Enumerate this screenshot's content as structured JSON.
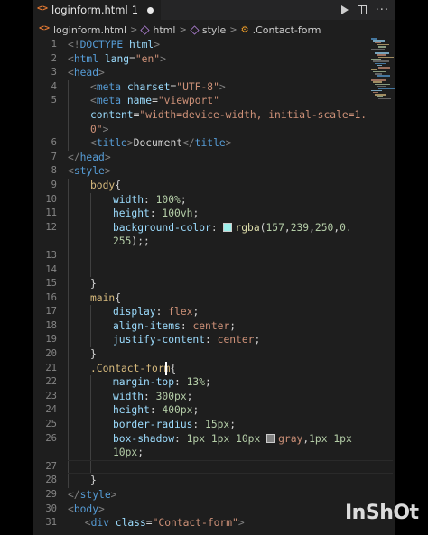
{
  "tab": {
    "filename": "loginform.html",
    "badge": "1"
  },
  "breadcrumb": [
    "loginform.html",
    "html",
    "style",
    ".Contact-form"
  ],
  "code_lines": [
    {
      "n": "1",
      "segs": [
        {
          "c": "t-br",
          "t": "<!"
        },
        {
          "c": "t-tag",
          "t": "DOCTYPE"
        },
        {
          "c": "t-def",
          "t": " "
        },
        {
          "c": "t-attr",
          "t": "html"
        },
        {
          "c": "t-br",
          "t": ">"
        }
      ],
      "indent": 0
    },
    {
      "n": "2",
      "segs": [
        {
          "c": "t-br",
          "t": "<"
        },
        {
          "c": "t-tag",
          "t": "html"
        },
        {
          "c": "t-def",
          "t": " "
        },
        {
          "c": "t-attr",
          "t": "lang"
        },
        {
          "c": "t-def",
          "t": "="
        },
        {
          "c": "t-str",
          "t": "\"en\""
        },
        {
          "c": "t-br",
          "t": ">"
        }
      ],
      "indent": 0
    },
    {
      "n": "3",
      "segs": [
        {
          "c": "t-br",
          "t": "<"
        },
        {
          "c": "t-tag",
          "t": "head"
        },
        {
          "c": "t-br",
          "t": ">"
        }
      ],
      "indent": 0
    },
    {
      "n": "4",
      "segs": [
        {
          "c": "t-br",
          "t": "<"
        },
        {
          "c": "t-tag",
          "t": "meta"
        },
        {
          "c": "t-def",
          "t": " "
        },
        {
          "c": "t-attr",
          "t": "charset"
        },
        {
          "c": "t-def",
          "t": "="
        },
        {
          "c": "t-str",
          "t": "\"UTF-8\""
        },
        {
          "c": "t-br",
          "t": ">"
        }
      ],
      "indent": 1
    },
    {
      "n": "5",
      "segs": [
        {
          "c": "t-br",
          "t": "<"
        },
        {
          "c": "t-tag",
          "t": "meta"
        },
        {
          "c": "t-def",
          "t": " "
        },
        {
          "c": "t-attr",
          "t": "name"
        },
        {
          "c": "t-def",
          "t": "="
        },
        {
          "c": "t-str",
          "t": "\"viewport\""
        }
      ],
      "indent": 1
    },
    {
      "n": "",
      "segs": [
        {
          "c": "t-attr",
          "t": "content"
        },
        {
          "c": "t-def",
          "t": "="
        },
        {
          "c": "t-str",
          "t": "\"width=device-width, initial-scale=1."
        }
      ],
      "indent": 1
    },
    {
      "n": "",
      "segs": [
        {
          "c": "t-str",
          "t": "0\""
        },
        {
          "c": "t-br",
          "t": ">"
        }
      ],
      "indent": 1
    },
    {
      "n": "6",
      "segs": [
        {
          "c": "t-br",
          "t": "<"
        },
        {
          "c": "t-tag",
          "t": "title"
        },
        {
          "c": "t-br",
          "t": ">"
        },
        {
          "c": "t-def",
          "t": "Document"
        },
        {
          "c": "t-br",
          "t": "</"
        },
        {
          "c": "t-tag",
          "t": "title"
        },
        {
          "c": "t-br",
          "t": ">"
        }
      ],
      "indent": 1
    },
    {
      "n": "7",
      "segs": [
        {
          "c": "t-br",
          "t": "</"
        },
        {
          "c": "t-tag",
          "t": "head"
        },
        {
          "c": "t-br",
          "t": ">"
        }
      ],
      "indent": 0
    },
    {
      "n": "8",
      "segs": [
        {
          "c": "t-br",
          "t": "<"
        },
        {
          "c": "t-tag",
          "t": "style"
        },
        {
          "c": "t-br",
          "t": ">"
        }
      ],
      "indent": 0
    },
    {
      "n": "9",
      "segs": [
        {
          "c": "t-sel",
          "t": "body"
        },
        {
          "c": "t-def",
          "t": "{"
        }
      ],
      "indent": 1
    },
    {
      "n": "10",
      "segs": [
        {
          "c": "t-prop",
          "t": "width"
        },
        {
          "c": "t-def",
          "t": ": "
        },
        {
          "c": "t-num",
          "t": "100%"
        },
        {
          "c": "t-def",
          "t": ";"
        }
      ],
      "indent": 2
    },
    {
      "n": "11",
      "segs": [
        {
          "c": "t-prop",
          "t": "height"
        },
        {
          "c": "t-def",
          "t": ": "
        },
        {
          "c": "t-num",
          "t": "100vh"
        },
        {
          "c": "t-def",
          "t": ";"
        }
      ],
      "indent": 2
    },
    {
      "n": "12",
      "segs": [
        {
          "c": "t-prop",
          "t": "background-color"
        },
        {
          "c": "t-def",
          "t": ": "
        },
        {
          "c": "swatch",
          "t": "#9defea"
        },
        {
          "c": "t-fn",
          "t": "rgba"
        },
        {
          "c": "t-def",
          "t": "("
        },
        {
          "c": "t-num",
          "t": "157"
        },
        {
          "c": "t-def",
          "t": ","
        },
        {
          "c": "t-num",
          "t": "239"
        },
        {
          "c": "t-def",
          "t": ","
        },
        {
          "c": "t-num",
          "t": "250"
        },
        {
          "c": "t-def",
          "t": ","
        },
        {
          "c": "t-num",
          "t": "0."
        }
      ],
      "indent": 2
    },
    {
      "n": "",
      "segs": [
        {
          "c": "t-num",
          "t": "255"
        },
        {
          "c": "t-def",
          "t": ");;"
        }
      ],
      "indent": 2
    },
    {
      "n": "13",
      "segs": [],
      "indent": 2
    },
    {
      "n": "14",
      "segs": [],
      "indent": 2
    },
    {
      "n": "15",
      "segs": [
        {
          "c": "t-def",
          "t": "}"
        }
      ],
      "indent": 1
    },
    {
      "n": "16",
      "segs": [
        {
          "c": "t-sel",
          "t": "main"
        },
        {
          "c": "t-def",
          "t": "{"
        }
      ],
      "indent": 1
    },
    {
      "n": "17",
      "segs": [
        {
          "c": "t-prop",
          "t": "display"
        },
        {
          "c": "t-def",
          "t": ": "
        },
        {
          "c": "t-str",
          "t": "flex"
        },
        {
          "c": "t-def",
          "t": ";"
        }
      ],
      "indent": 2
    },
    {
      "n": "18",
      "segs": [
        {
          "c": "t-prop",
          "t": "align-items"
        },
        {
          "c": "t-def",
          "t": ": "
        },
        {
          "c": "t-str",
          "t": "center"
        },
        {
          "c": "t-def",
          "t": ";"
        }
      ],
      "indent": 2
    },
    {
      "n": "19",
      "segs": [
        {
          "c": "t-prop",
          "t": "justify-content"
        },
        {
          "c": "t-def",
          "t": ": "
        },
        {
          "c": "t-str",
          "t": "center"
        },
        {
          "c": "t-def",
          "t": ";"
        }
      ],
      "indent": 2
    },
    {
      "n": "20",
      "segs": [
        {
          "c": "t-def",
          "t": "}"
        }
      ],
      "indent": 1
    },
    {
      "n": "21",
      "segs": [
        {
          "c": "t-sel",
          "t": ".Contact-form"
        },
        {
          "c": "t-def",
          "t": "{"
        }
      ],
      "indent": 1
    },
    {
      "n": "22",
      "segs": [
        {
          "c": "t-prop",
          "t": "margin-top"
        },
        {
          "c": "t-def",
          "t": ": "
        },
        {
          "c": "t-num",
          "t": "13%"
        },
        {
          "c": "t-def",
          "t": ";"
        }
      ],
      "indent": 2
    },
    {
      "n": "23",
      "segs": [
        {
          "c": "t-prop",
          "t": "width"
        },
        {
          "c": "t-def",
          "t": ": "
        },
        {
          "c": "t-num",
          "t": "300px"
        },
        {
          "c": "t-def",
          "t": ";"
        }
      ],
      "indent": 2
    },
    {
      "n": "24",
      "segs": [
        {
          "c": "t-prop",
          "t": "height"
        },
        {
          "c": "t-def",
          "t": ": "
        },
        {
          "c": "t-num",
          "t": "400px"
        },
        {
          "c": "t-def",
          "t": ";"
        }
      ],
      "indent": 2
    },
    {
      "n": "25",
      "segs": [
        {
          "c": "t-prop",
          "t": "border-radius"
        },
        {
          "c": "t-def",
          "t": ": "
        },
        {
          "c": "t-num",
          "t": "15px"
        },
        {
          "c": "t-def",
          "t": ";"
        }
      ],
      "indent": 2
    },
    {
      "n": "26",
      "segs": [
        {
          "c": "t-prop",
          "t": "box-shadow"
        },
        {
          "c": "t-def",
          "t": ": "
        },
        {
          "c": "t-num",
          "t": "1px"
        },
        {
          "c": "t-def",
          "t": " "
        },
        {
          "c": "t-num",
          "t": "1px"
        },
        {
          "c": "t-def",
          "t": " "
        },
        {
          "c": "t-num",
          "t": "10px"
        },
        {
          "c": "t-def",
          "t": " "
        },
        {
          "c": "swatch",
          "t": "#808080"
        },
        {
          "c": "t-str",
          "t": "gray"
        },
        {
          "c": "t-def",
          "t": ","
        },
        {
          "c": "t-num",
          "t": "1px"
        },
        {
          "c": "t-def",
          "t": " "
        },
        {
          "c": "t-num",
          "t": "1px"
        }
      ],
      "indent": 2
    },
    {
      "n": "",
      "segs": [
        {
          "c": "t-num",
          "t": "10px"
        },
        {
          "c": "t-def",
          "t": ";"
        }
      ],
      "indent": 2
    },
    {
      "n": "27",
      "segs": [],
      "indent": 2
    },
    {
      "n": "28",
      "segs": [
        {
          "c": "t-def",
          "t": "}"
        }
      ],
      "indent": 1
    },
    {
      "n": "29",
      "segs": [
        {
          "c": "t-br",
          "t": "</"
        },
        {
          "c": "t-tag",
          "t": "style"
        },
        {
          "c": "t-br",
          "t": ">"
        }
      ],
      "indent": 0
    },
    {
      "n": "30",
      "segs": [
        {
          "c": "t-br",
          "t": "<"
        },
        {
          "c": "t-tag",
          "t": "body"
        },
        {
          "c": "t-br",
          "t": ">"
        }
      ],
      "indent": 0
    },
    {
      "n": "31",
      "segs": [
        {
          "c": "t-br",
          "t": "<"
        },
        {
          "c": "t-tag",
          "t": "div"
        },
        {
          "c": "t-def",
          "t": " "
        },
        {
          "c": "t-attr",
          "t": "class"
        },
        {
          "c": "t-def",
          "t": "="
        },
        {
          "c": "t-str",
          "t": "\"Contact-form\""
        },
        {
          "c": "t-br",
          "t": ">"
        }
      ],
      "indent": 0.75
    }
  ],
  "watermark": "InShOt"
}
